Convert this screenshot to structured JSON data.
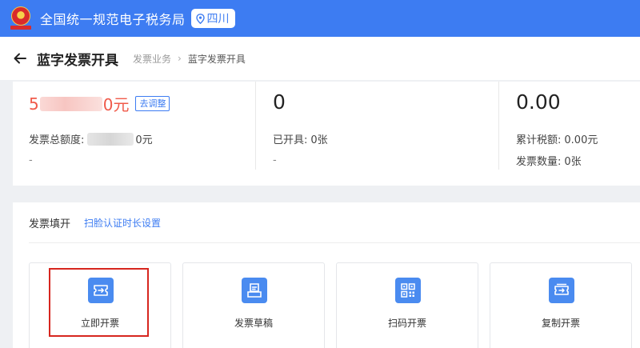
{
  "header": {
    "site_title": "全国统一规范电子税务局",
    "region": "四川",
    "brand_color": "#3d7cf2"
  },
  "page": {
    "title": "蓝字发票开具",
    "breadcrumb": [
      "发票业务",
      "蓝字发票开具"
    ]
  },
  "stats": {
    "quota_prefix": "5",
    "quota_suffix": "0元",
    "adjust_label": "去调整",
    "total_quota_label": "发票总额度:",
    "total_quota_suffix": "0元",
    "col1_dash": "-",
    "issued_count": "0",
    "issued_label": "已开具:",
    "issued_value": "0张",
    "col2_dash": "-",
    "tax_total": "0.00",
    "tax_label": "累计税额:",
    "tax_value": "0.00元",
    "invoice_count_label": "发票数量:",
    "invoice_count_value": "0张"
  },
  "section": {
    "title": "发票填开",
    "link": "扫脸认证时长设置",
    "tiles": [
      {
        "label": "立即开票",
        "icon": "ticket-arrow-icon"
      },
      {
        "label": "发票草稿",
        "icon": "draft-document-icon"
      },
      {
        "label": "扫码开票",
        "icon": "qr-code-icon"
      },
      {
        "label": "复制开票",
        "icon": "copy-ticket-icon"
      }
    ]
  }
}
